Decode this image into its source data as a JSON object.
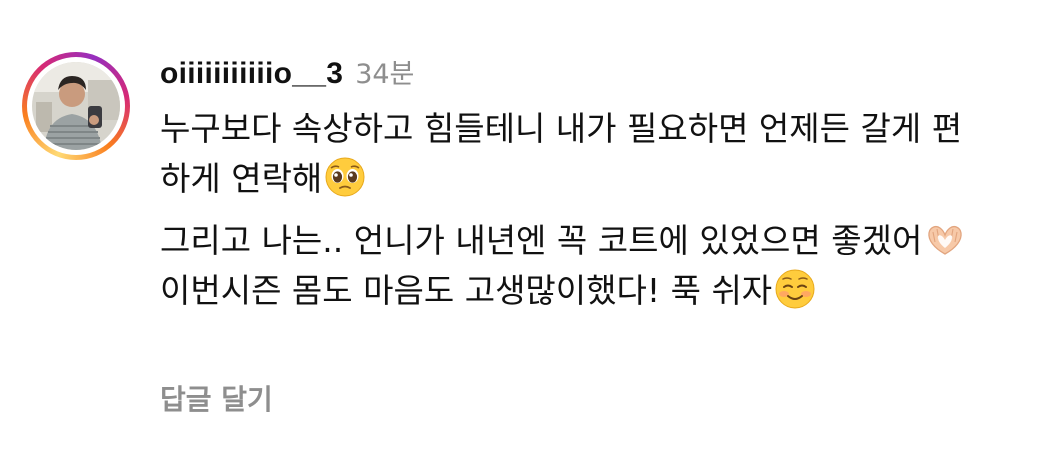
{
  "comment": {
    "username": "oiiiiiiiiiiio__3",
    "timestamp": "34분",
    "paragraph1_text": "누구보다 속상하고 힘들테니 내가 필요하면 언제든 갈게 편하게 연락해",
    "paragraph1_emoji": "pleading-face-emoji",
    "paragraph2_part1": "그리고 나는.. 언니가 내년엔 꼭 코트에 있었으면 좋겠어",
    "paragraph2_emoji1": "heart-hands-emoji",
    "paragraph2_part2": " 이번시즌 몸도 마음도 고생많이했다! 푹 쉬자",
    "paragraph2_emoji2": "smiling-face-emoji"
  },
  "reply_button_label": "답글 달기",
  "colors": {
    "text": "#111111",
    "secondary": "#8e8e8e",
    "ring_gradient": [
      "#feda75",
      "#fa7e1e",
      "#d62976",
      "#962fbf"
    ]
  }
}
